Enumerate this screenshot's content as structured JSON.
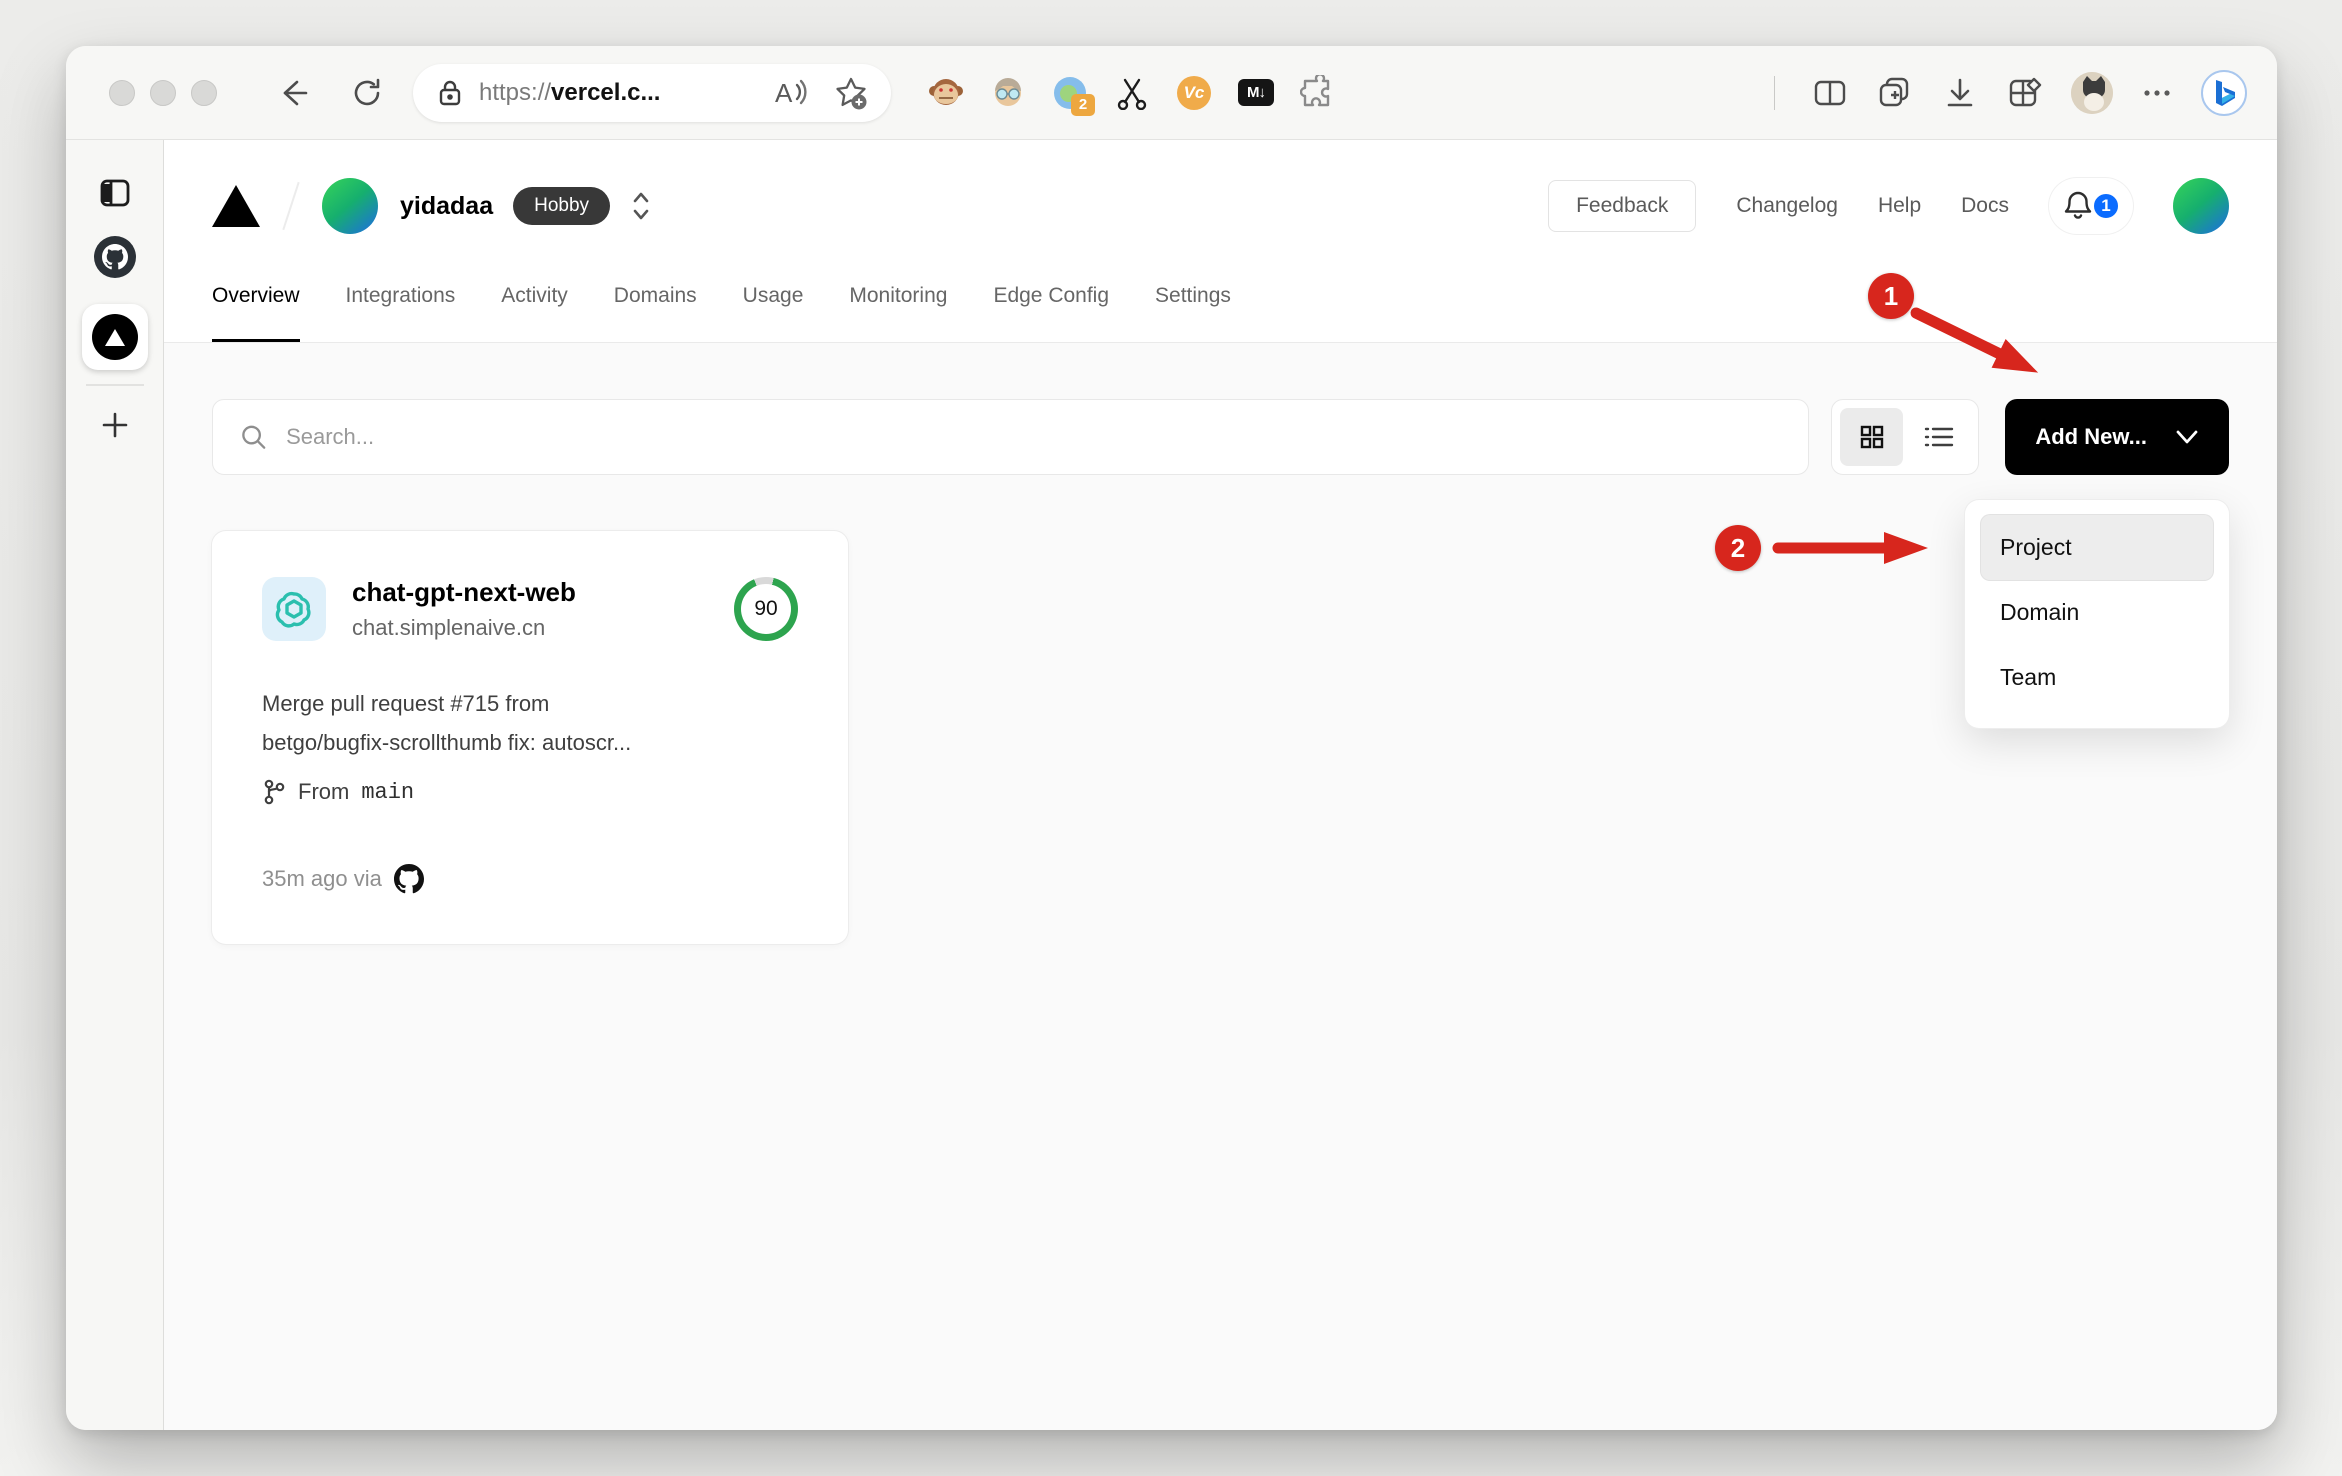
{
  "browser": {
    "url_scheme": "https://",
    "url_host": "vercel.c...",
    "ext_badge_count": "2",
    "vc_label": "Vc",
    "md_label": "M↓"
  },
  "vercel": {
    "header": {
      "team_name": "yidadaa",
      "plan_badge": "Hobby",
      "feedback_label": "Feedback",
      "links": [
        "Changelog",
        "Help",
        "Docs"
      ],
      "notification_count": "1"
    },
    "tabs": [
      {
        "label": "Overview"
      },
      {
        "label": "Integrations"
      },
      {
        "label": "Activity"
      },
      {
        "label": "Domains"
      },
      {
        "label": "Usage"
      },
      {
        "label": "Monitoring"
      },
      {
        "label": "Edge Config"
      },
      {
        "label": "Settings"
      }
    ],
    "toolbar": {
      "search_placeholder": "Search...",
      "add_new_label": "Add New..."
    },
    "dropdown": {
      "items": [
        "Project",
        "Domain",
        "Team"
      ],
      "active_item": "Project"
    },
    "card": {
      "name": "chat-gpt-next-web",
      "domain": "chat.simplenaive.cn",
      "score": "90",
      "commit_line1": "Merge pull request #715 from",
      "commit_line2": "betgo/bugfix-scrollthumb fix: autoscr...",
      "branch_prefix": "From",
      "branch_name": "main",
      "deployed_label": "35m ago via"
    }
  },
  "annotations": {
    "step1": "1",
    "step2": "2"
  },
  "colors": {
    "annotation_red": "#d7261d",
    "notification_blue": "#0b6cff",
    "gauge_green": "#2da44e",
    "button_black": "#000000"
  }
}
